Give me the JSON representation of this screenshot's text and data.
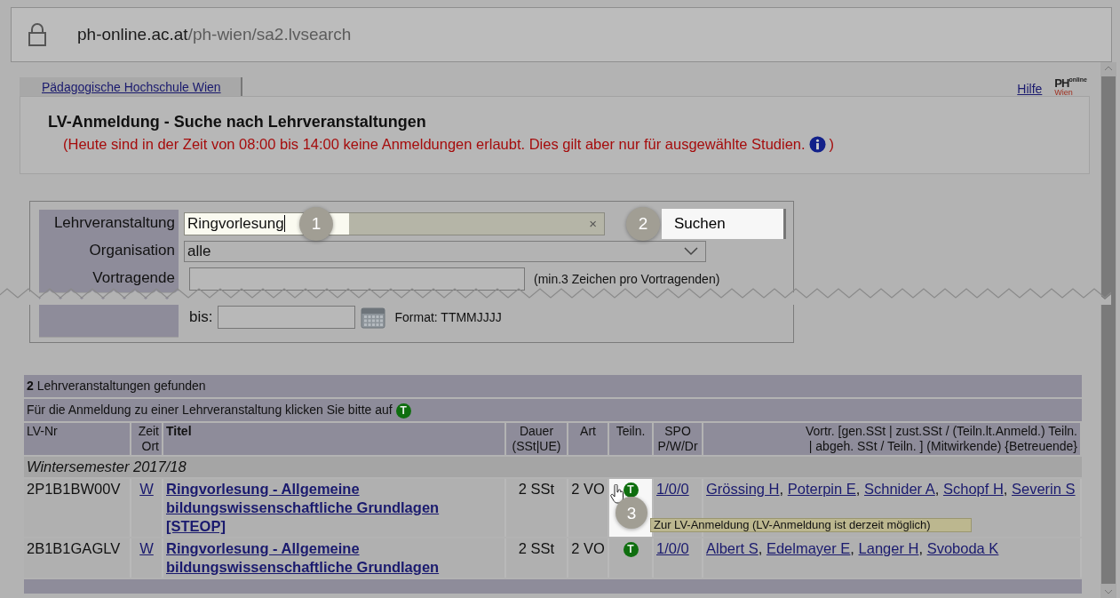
{
  "browser": {
    "url_host": "ph-online.ac.at",
    "url_path": "/ph-wien/sa2.lvsearch"
  },
  "tab": "Pädagogische Hochschule Wien",
  "help_link": "Hilfe",
  "logo": {
    "mark": "PH",
    "sup": "online",
    "sub": "Wien"
  },
  "heading": "LV-Anmeldung - Suche nach Lehrveranstaltungen",
  "notice": {
    "before": "(Heute sind in der Zeit von 08:00 bis 14:00 keine Anmeldungen erlaubt. Dies gilt aber nur für ausgewählte Studien.",
    "after": ")"
  },
  "search_form": {
    "fields": [
      {
        "label": "Lehrveranstaltung",
        "kind": "text",
        "value": "Ringvorlesung",
        "clear": "×",
        "callout": "1"
      },
      {
        "label": "Organisation",
        "kind": "select",
        "value": "alle"
      },
      {
        "label": "Vortragende",
        "kind": "text",
        "hint": "(min.3 Zeichen pro Vortragenden)"
      }
    ],
    "button": {
      "label": "Suchen",
      "callout": "2"
    },
    "date_row": {
      "label": "bis:",
      "hint": "Format: TTMMJJJJ"
    }
  },
  "results": {
    "count": "2",
    "count_text": "Lehrveranstaltungen gefunden",
    "instruction": "Für die Anmeldung zu einer Lehrveranstaltung klicken Sie bitte auf",
    "instruction_icon": "T",
    "columns": [
      {
        "lines": [
          "LV-Nr"
        ]
      },
      {
        "lines": [
          "Zeit",
          "Ort"
        ]
      },
      {
        "lines": [
          "Titel"
        ]
      },
      {
        "lines": [
          "Dauer",
          "(SSt|UE)"
        ]
      },
      {
        "lines": [
          "Art"
        ]
      },
      {
        "lines": [
          "Teiln."
        ]
      },
      {
        "lines": [
          "SPO",
          "P/W/Dr"
        ]
      },
      {
        "lines": [
          "Vortr. [gen.SSt | zust.SSt / (Teiln.lt.Anmeld.) Teiln.",
          "| abgeh. SSt / Teiln. ] (Mitwirkende) {Betreuende}"
        ]
      }
    ],
    "lecturer_separator": ",",
    "group": "Wintersemester 2017/18",
    "rows": [
      {
        "lv_nr": "2P1B1BW00V",
        "zeit": "W",
        "title": "Ringvorlesung - Allgemeine bildungswissenschaftliche Grundlagen [STEOP]",
        "dauer": "2 SSt",
        "art": "2 VO",
        "teiln_icon": "T",
        "spo": "1/0/0",
        "lecturers": [
          "Grössing H",
          "Poterpin E",
          "Schnider A",
          "Schopf H",
          "Severin S"
        ],
        "callout": "3",
        "tooltip": "Zur LV-Anmeldung (LV-Anmeldung ist derzeit möglich)"
      },
      {
        "lv_nr": "2B1B1GAGLV",
        "zeit": "W",
        "title": "Ringvorlesung - Allgemeine bildungswissenschaftliche Grundlagen",
        "dauer": "2 SSt",
        "art": "2 VO",
        "teiln_icon": "T",
        "spo": "1/0/0",
        "lecturers": [
          "Albert S",
          "Edelmayer E",
          "Langer H",
          "Svoboda K"
        ]
      }
    ]
  }
}
